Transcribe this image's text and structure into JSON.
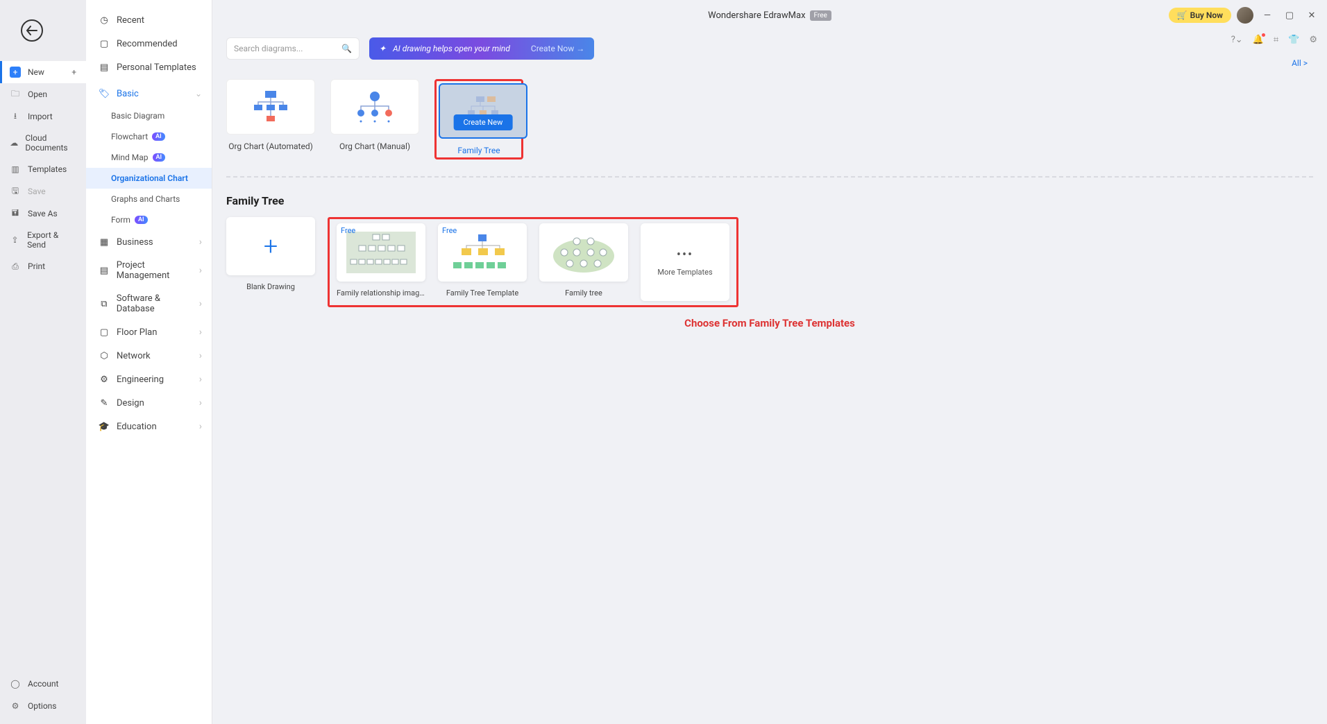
{
  "app": {
    "title": "Wondershare EdrawMax",
    "edition": "Free"
  },
  "titlebar": {
    "buy_now": "Buy Now"
  },
  "file_menu": {
    "new": "New",
    "open": "Open",
    "import": "Import",
    "cloud": "Cloud Documents",
    "templates": "Templates",
    "save": "Save",
    "save_as": "Save As",
    "export": "Export & Send",
    "print": "Print",
    "account": "Account",
    "options": "Options"
  },
  "cat_nav": {
    "recent": "Recent",
    "recommended": "Recommended",
    "personal": "Personal Templates",
    "basic": "Basic",
    "basic_sub": {
      "basic_diagram": "Basic Diagram",
      "flowchart": "Flowchart",
      "mind_map": "Mind Map",
      "org_chart": "Organizational Chart",
      "graphs": "Graphs and Charts",
      "form": "Form"
    },
    "business": "Business",
    "project": "Project Management",
    "software": "Software & Database",
    "floor": "Floor Plan",
    "network": "Network",
    "engineering": "Engineering",
    "design": "Design",
    "education": "Education",
    "ai_badge": "AI"
  },
  "toolbar": {
    "search_placeholder": "Search diagrams...",
    "ai_banner": "AI drawing helps open your mind",
    "create_now": "Create Now  →",
    "all_link": "All  >"
  },
  "types": {
    "org_auto": "Org Chart (Automated)",
    "org_manual": "Org Chart (Manual)",
    "family_tree": "Family Tree",
    "create_new_btn": "Create New"
  },
  "section": {
    "title": "Family Tree"
  },
  "templates": {
    "blank": "Blank Drawing",
    "t1": "Family relationship image ...",
    "t2": "Family Tree Template",
    "t3": "Family tree",
    "more": "More Templates",
    "free_tag": "Free"
  },
  "annotation": "Choose From Family Tree Templates"
}
